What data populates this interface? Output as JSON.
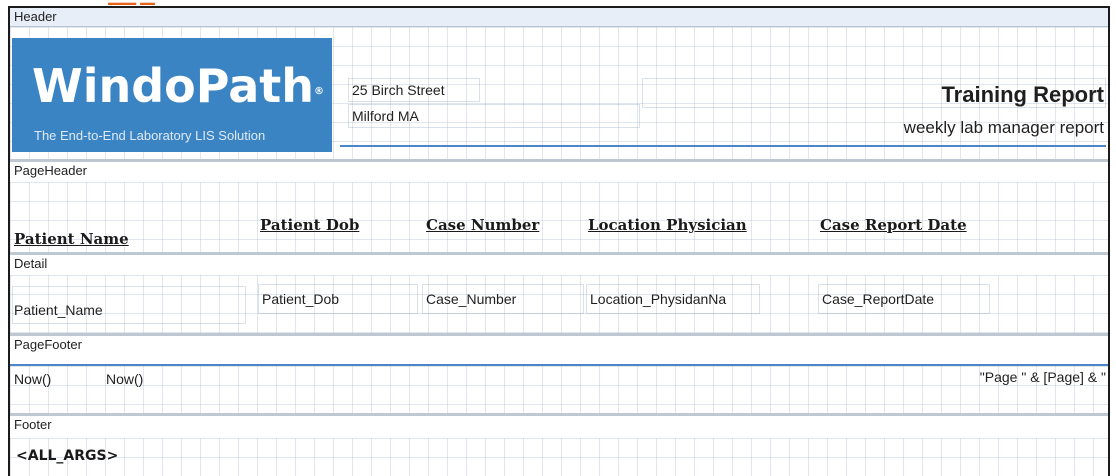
{
  "sections": {
    "header": "Header",
    "page_header": "PageHeader",
    "detail": "Detail",
    "page_footer": "PageFooter",
    "footer": "Footer"
  },
  "logo": {
    "wordmark": "WindoPath",
    "registered": "®",
    "tagline": "The End-to-End Laboratory LIS Solution"
  },
  "address": {
    "line1": "25 Birch Street",
    "line2": "Milford MA"
  },
  "report": {
    "title": "Training Report",
    "subtitle": "weekly lab manager report"
  },
  "columns": [
    "Patient Name",
    "Patient Dob",
    "Case Number",
    "Location Physician",
    "Case Report Date"
  ],
  "detail_fields": [
    "Patient_Name",
    "Patient_Dob",
    "Case_Number",
    "Location_PhysidanNa",
    "Case_ReportDate"
  ],
  "page_footer": {
    "now1": "Now()",
    "now2": "Now()",
    "page_expr": "\"Page \" & [Page] & \""
  },
  "footer": {
    "args": "<ALL_ARGS>"
  },
  "colors": {
    "logo_blue": "#3b84c4",
    "section_bar": "#e7eef7",
    "rule_blue": "#4a86c9",
    "fragment_orange": "#e8621a"
  }
}
